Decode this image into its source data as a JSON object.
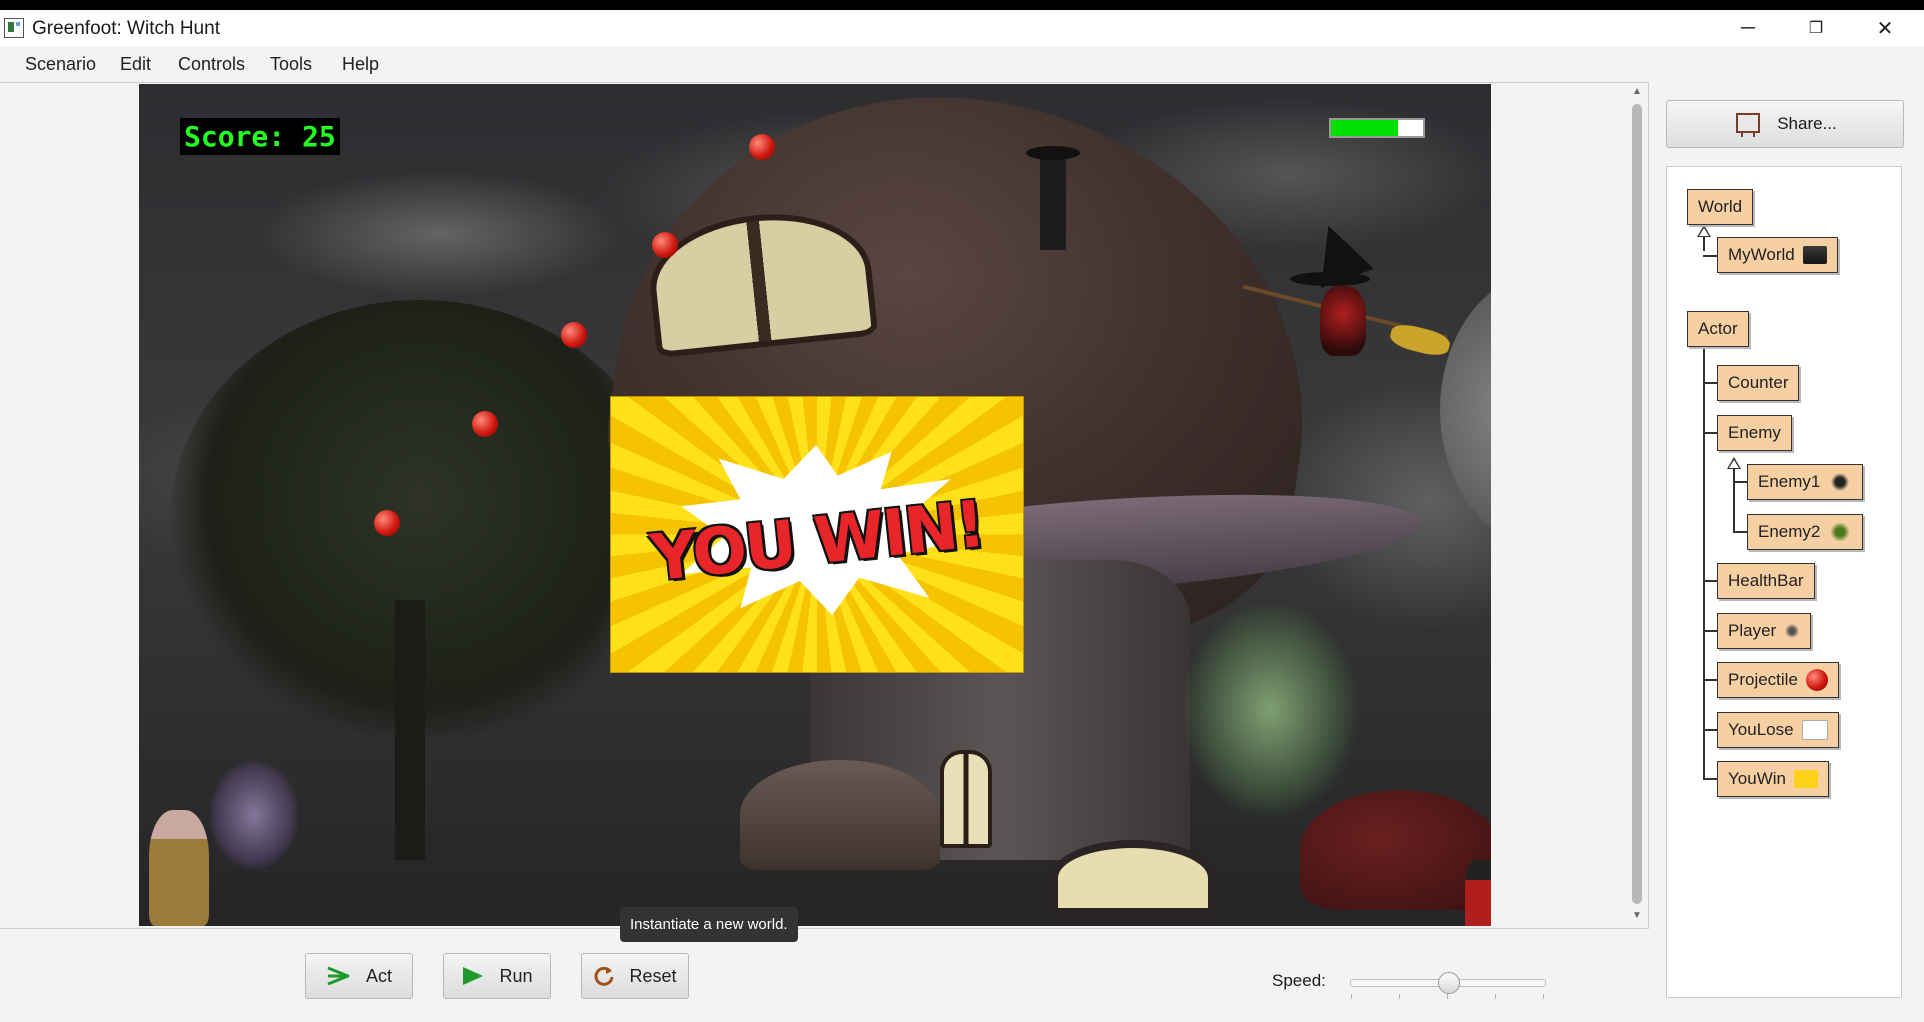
{
  "window": {
    "title": "Greenfoot: Witch Hunt",
    "controls": [
      "─",
      "❐",
      "✕"
    ]
  },
  "menu": [
    "Scenario",
    "Edit",
    "Controls",
    "Tools",
    "Help"
  ],
  "world": {
    "score_text": "Score: 25",
    "health_fraction": 0.73,
    "youwin_text": "YOU WIN!",
    "colors": {
      "score": "#22ff22",
      "health": "#00e000",
      "youwin_bg": "#ffe11a"
    }
  },
  "tooltip": "Instantiate a new world.",
  "controls": {
    "act": {
      "label": "Act",
      "icon": "act-arrow-icon"
    },
    "run": {
      "label": "Run",
      "icon": "play-icon"
    },
    "reset": {
      "label": "Reset",
      "icon": "reset-icon"
    },
    "speed_label": "Speed:",
    "speed_fraction": 0.5
  },
  "sidebar": {
    "share_label": "Share...",
    "classes": {
      "world": "World",
      "myworld": "MyWorld",
      "actor": "Actor",
      "counter": "Counter",
      "enemy": "Enemy",
      "enemy1": "Enemy1",
      "enemy2": "Enemy2",
      "healthbar": "HealthBar",
      "player": "Player",
      "projectile": "Projectile",
      "youlose": "YouLose",
      "youwin": "YouWin"
    }
  }
}
